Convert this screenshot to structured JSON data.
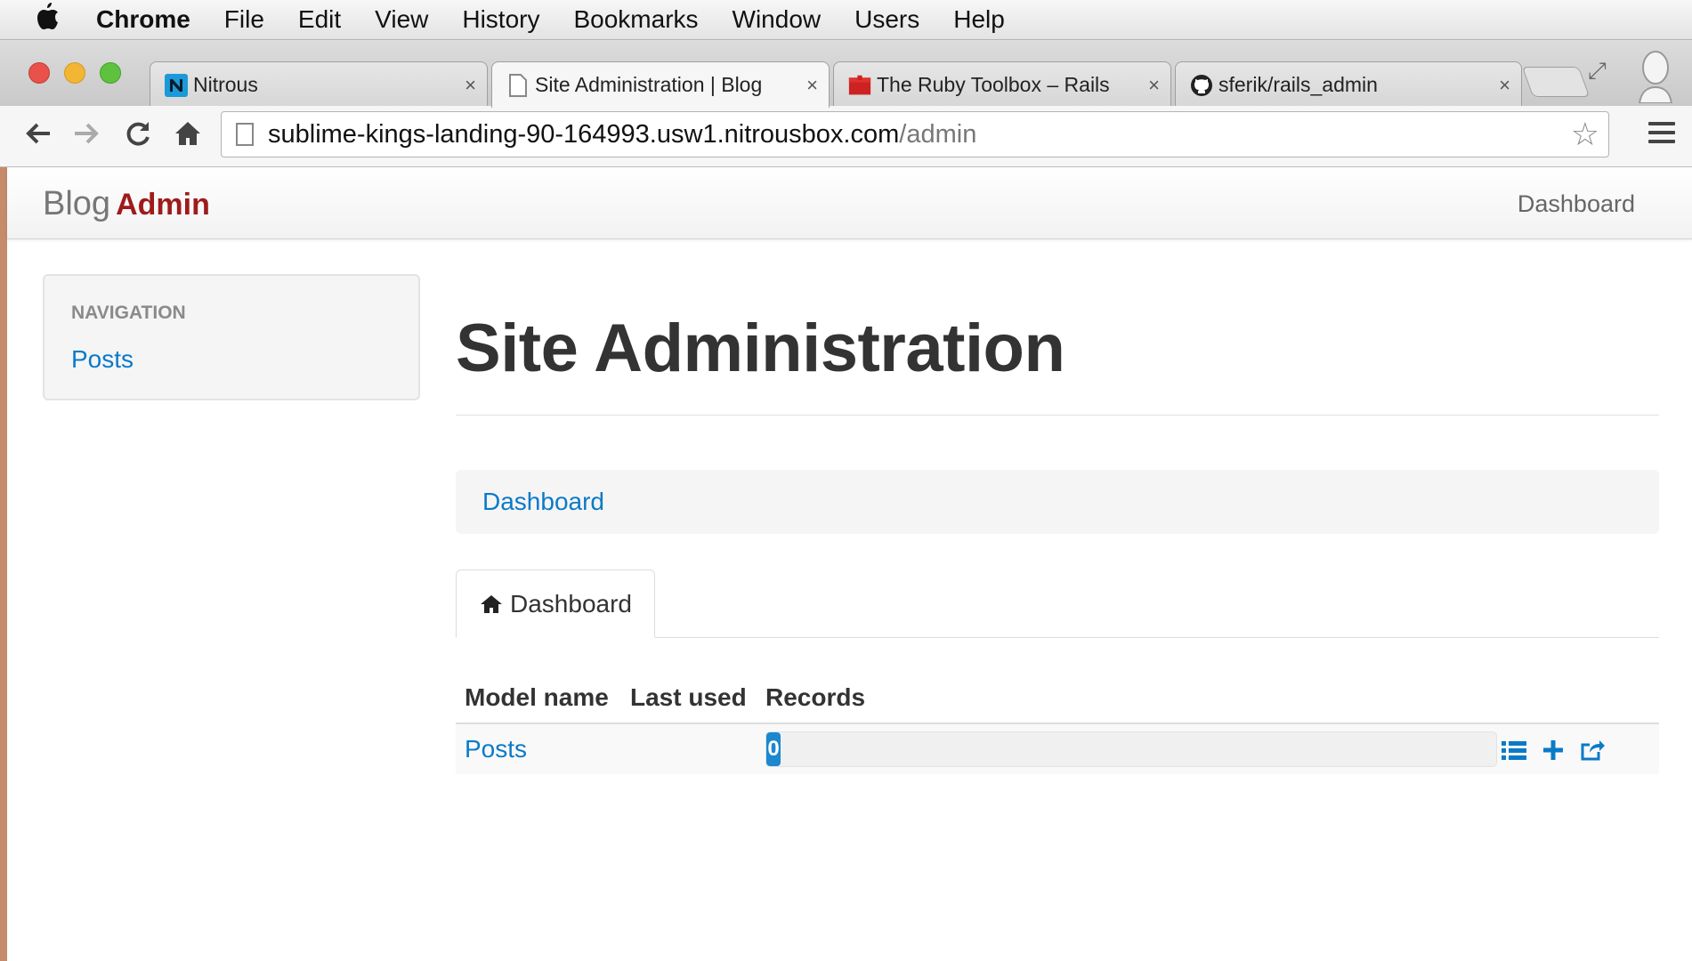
{
  "menubar": {
    "app": "Chrome",
    "items": [
      "File",
      "Edit",
      "View",
      "History",
      "Bookmarks",
      "Window",
      "Users",
      "Help"
    ]
  },
  "browser": {
    "tabs": [
      {
        "label": "Nitrous",
        "icon": "nitrous-logo-icon",
        "close": "×"
      },
      {
        "label": "Site Administration | Blog",
        "icon": "page-icon",
        "close": "×",
        "active": true
      },
      {
        "label": "The Ruby Toolbox – Rails",
        "icon": "ruby-toolbox-icon",
        "close": "×"
      },
      {
        "label": "sferik/rails_admin",
        "icon": "github-icon",
        "close": "×"
      }
    ],
    "address": {
      "host": "sublime-kings-landing-90-164993.usw1.nitrousbox.com",
      "path": "/admin"
    }
  },
  "navbar": {
    "brand_text": "Blog",
    "brand_strong": "Admin",
    "right_link": "Dashboard",
    "brand_color": "#9e1b1b"
  },
  "sidebar": {
    "header": "NAVIGATION",
    "items": [
      {
        "label": "Posts"
      }
    ]
  },
  "main": {
    "title": "Site Administration",
    "breadcrumb": "Dashboard",
    "tab_label": "Dashboard",
    "table": {
      "columns": [
        "Model name",
        "Last used",
        "Records"
      ],
      "rows": [
        {
          "model": "Posts",
          "last_used": "",
          "records": "0",
          "records_fraction": 0
        }
      ]
    },
    "link_color": "#0a7ac8"
  }
}
